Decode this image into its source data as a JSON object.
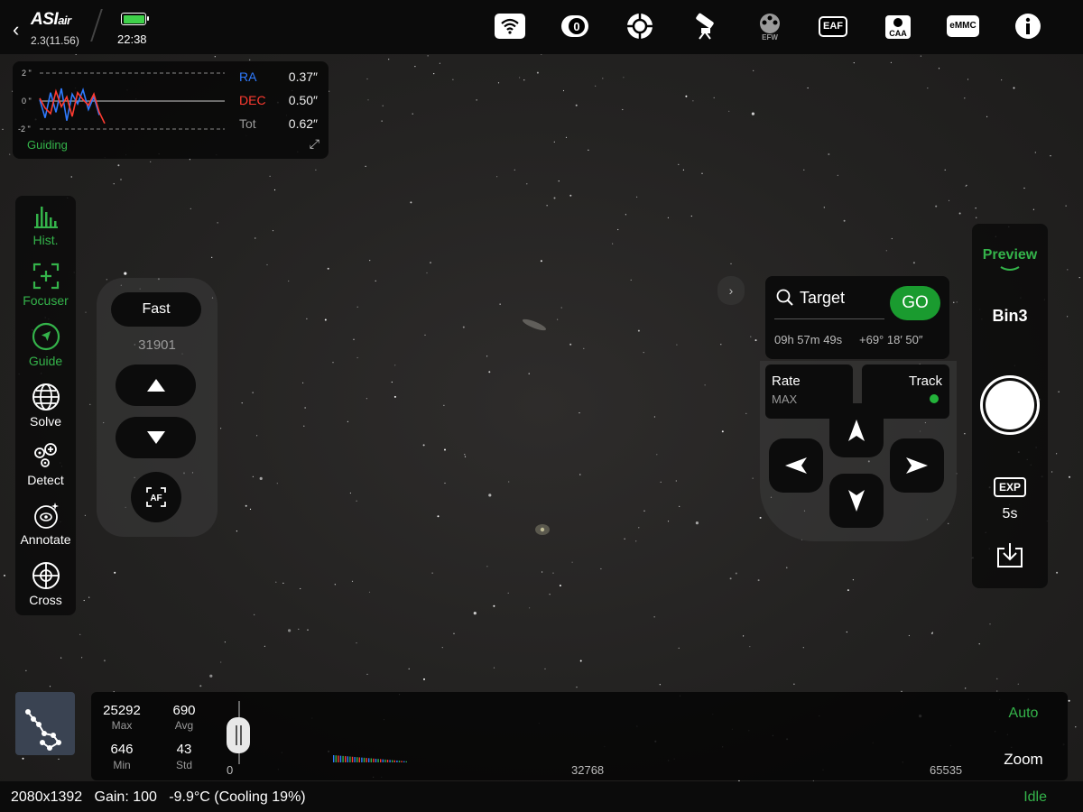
{
  "app": {
    "logo": "ASI",
    "logo_suffix": "air",
    "version": "2.3(11.56)",
    "time": "22:38",
    "battery_level": 1.0
  },
  "toolbar": {
    "icons": [
      {
        "name": "wifi-icon"
      },
      {
        "name": "camera-icon",
        "text": "0"
      },
      {
        "name": "guide-target-icon"
      },
      {
        "name": "telescope-mount-icon"
      },
      {
        "name": "filter-wheel-icon",
        "text": "EFW"
      },
      {
        "name": "focuser-eaf-icon",
        "text": "EAF"
      },
      {
        "name": "rotator-caa-icon",
        "text": "CAA"
      },
      {
        "name": "storage-emmc-icon",
        "text": "eMMC"
      },
      {
        "name": "info-icon"
      }
    ]
  },
  "guiding": {
    "title": "Guiding",
    "y_ticks": [
      "2 \"",
      "0 \"",
      "-2 \""
    ],
    "ra_label": "RA",
    "ra_value": "0.37″",
    "dec_label": "DEC",
    "dec_value": "0.50″",
    "tot_label": "Tot",
    "tot_value": "0.62″",
    "ra_color": "#2f7bff",
    "dec_color": "#ff3b30",
    "ra_series": [
      0.1,
      -1.2,
      0.6,
      -0.8,
      0.9,
      -1.4,
      0.5,
      -0.2,
      0.8,
      -0.6,
      0.3,
      -1.0
    ],
    "dec_series": [
      0.2,
      -0.5,
      -0.9,
      0.7,
      -0.4,
      0.3,
      -1.1,
      0.6,
      0.1,
      -0.3,
      0.5,
      -0.8,
      -1.6
    ]
  },
  "left_tools": [
    {
      "name": "hist",
      "label": "Hist.",
      "active": true
    },
    {
      "name": "focuser",
      "label": "Focuser",
      "active": true
    },
    {
      "name": "guide",
      "label": "Guide",
      "active": true
    },
    {
      "name": "solve",
      "label": "Solve",
      "active": false
    },
    {
      "name": "detect",
      "label": "Detect",
      "active": false
    },
    {
      "name": "annotate",
      "label": "Annotate",
      "active": false
    },
    {
      "name": "cross",
      "label": "Cross",
      "active": false
    }
  ],
  "focuser": {
    "speed_label": "Fast",
    "position": "31901",
    "af_label": "AF"
  },
  "mount": {
    "collapse_glyph": "›",
    "target_label": "Target",
    "go_label": "GO",
    "ra": "09h 57m 49s",
    "dec": "+69° 18′ 50″",
    "rate_label": "Rate",
    "rate_value": "MAX",
    "track_label": "Track",
    "track_on": true
  },
  "capture": {
    "mode_label": "Preview",
    "bin_label": "Bin3",
    "exp_label": "EXP",
    "exp_value": "5s"
  },
  "histogram": {
    "max_value": "25292",
    "max_label": "Max",
    "avg_value": "690",
    "avg_label": "Avg",
    "min_value": "646",
    "min_label": "Min",
    "std_value": "43",
    "std_label": "Std",
    "tick_start": "0",
    "tick_mid": "32768",
    "tick_end": "65535",
    "auto_label": "Auto",
    "zoom_label": "Zoom"
  },
  "status": {
    "resolution": "2080x1392",
    "gain_text": "Gain: 100",
    "temperature_text": "-9.9°C (Cooling 19%)",
    "state": "Idle"
  },
  "colors": {
    "accent_green": "#34b34a",
    "go_green": "#1a9b2f"
  }
}
